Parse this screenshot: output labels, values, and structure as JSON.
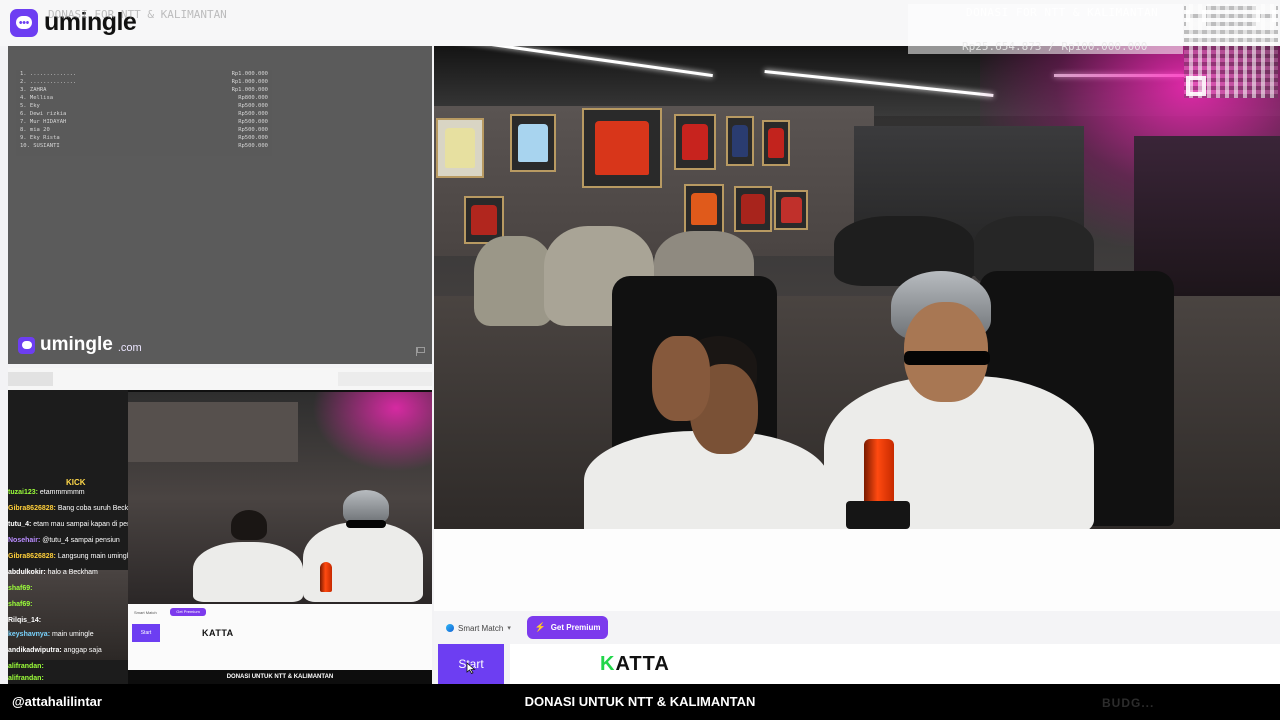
{
  "header": {
    "brand": "umingle",
    "ghost_title": "DONASI FOR NTT & KALIMANTAN",
    "donation_title": "DONASI FOR NTT & KALIMANTAN",
    "donation_amount": "Rp25.654.873 / Rp100.000.000"
  },
  "leaderboard": {
    "rows": [
      {
        "name": "1. ..............",
        "amount": "Rp1.000.000"
      },
      {
        "name": "2. ..............",
        "amount": "Rp1.000.000"
      },
      {
        "name": "3. ZAHRA",
        "amount": "Rp1.000.000"
      },
      {
        "name": "4. Mellisa",
        "amount": "Rp800.000"
      },
      {
        "name": "5. Eky",
        "amount": "Rp500.000"
      },
      {
        "name": "6. Dewi rizkia",
        "amount": "Rp500.000"
      },
      {
        "name": "7. Mur HIDAYAH",
        "amount": "Rp500.000"
      },
      {
        "name": "8. mia 20",
        "amount": "Rp500.000"
      },
      {
        "name": "9. Eky Rista",
        "amount": "Rp500.000"
      },
      {
        "name": "10. SUSIANTI",
        "amount": "Rp500.000"
      }
    ]
  },
  "panel_brand": {
    "name": "umingle",
    "domain": ".com"
  },
  "chat": {
    "kick_label": "KICK",
    "messages": [
      {
        "user": "tuzai123:",
        "text": " etammmmmm",
        "color": "#9cff3a"
      },
      {
        "user": "Gibra8626828:",
        "text": " Bang coba suruh Beckham juggling",
        "color": "#ffcf3a"
      },
      {
        "user": "tutu_4:",
        "text": " etam mau sampai kapan di persib?",
        "color": "#ffffff"
      },
      {
        "user": "Nosehair:",
        "text": " @tutu_4 sampai pensiun",
        "color": "#b98cff"
      },
      {
        "user": "Gibra8626828:",
        "text": " Langsung main umingle",
        "color": "#ffcf3a"
      },
      {
        "user": "abdulkokir:",
        "text": " halo a Beckham",
        "color": "#ffffff"
      },
      {
        "user": "shaf69:",
        "text": "",
        "color": "#9cff3a"
      },
      {
        "user": "shaf69:",
        "text": "",
        "color": "#9cff3a"
      },
      {
        "user": "Rilqis_14:",
        "text": "",
        "color": "#ffffff"
      },
      {
        "user": "keyshavnya:",
        "text": " main umingle",
        "color": "#7ad4ff"
      },
      {
        "user": "andikadwiputra:",
        "text": " anggap saja",
        "color": "#ffffff"
      },
      {
        "user": "alifrandan:",
        "text": "",
        "color": "#9cff3a"
      },
      {
        "user": "alifrandan:",
        "text": "",
        "color": "#9cff3a"
      }
    ]
  },
  "lower_left": {
    "smart_match": "Smart Match",
    "premium": "Get Premium",
    "start": "Start",
    "katta": "KATTA",
    "caption": "DONASI UNTUK NTT & KALIMANTAN"
  },
  "controls": {
    "smart_match_label": "Smart Match",
    "premium_label": "Get Premium",
    "start_label": "Start",
    "sponsor_k": "K",
    "sponsor_rest": "ATTA"
  },
  "bottom_bar": {
    "handle": "@attahalilintar",
    "center_text": "DONASI UNTUK NTT & KALIMANTAN",
    "ghost_text": "BUDG..."
  },
  "colors": {
    "brand_purple": "#6d3ef2",
    "premium_purple": "#7c3aed",
    "katta_green": "#22d64a"
  },
  "icons": [
    "umingle-logo-icon",
    "flag-icon",
    "smart-match-icon",
    "chevron-down-icon",
    "bolt-icon",
    "cursor-icon",
    "qr-code-icon"
  ]
}
